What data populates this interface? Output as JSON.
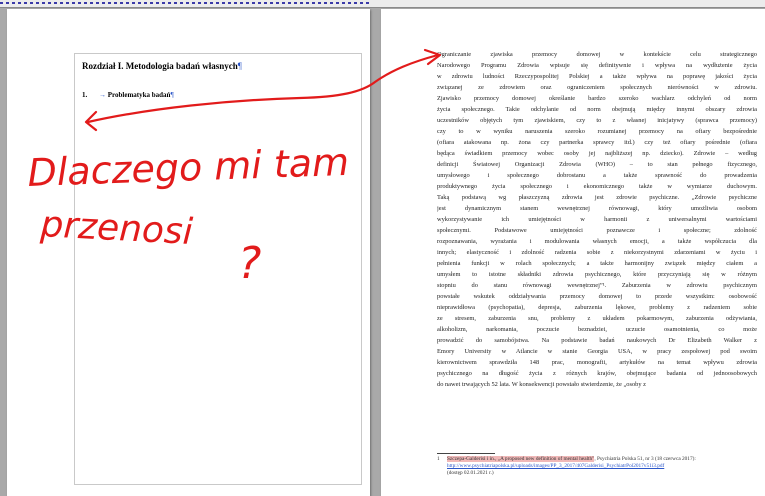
{
  "left_page": {
    "chapter_title": "Rozdział I. Metodologia badań własnych",
    "pilcrow": "¶",
    "section_number": "1.",
    "section_arrow": "→",
    "section_title": "Problematyka badań"
  },
  "right_page": {
    "body_lines": [
      "Ograniczanie zjawiska przemocy domowej w kontekście celu strategicznego",
      "Narodowego Programu Zdrowia wpisuje się definitywnie i wpływa na wydłużenie życia",
      "w zdrowiu ludności Rzeczypospolitej Polskiej a także wpływa na poprawę jakości życia",
      "związanej ze zdrowiem oraz ograniczeniem społecznych nierówności w zdrowiu.",
      "Zjawisko przemocy domowej określanie bardzo szeroko wachlarz odchyleń od norm",
      "życia społecznego. Takie odchylanie od norm obejmują między innymi obszary zdrowia",
      "uczestników objętych tym zjawiskiem, czy to z własnej inicjatywy (sprawca przemocy)",
      "czy to w wyniku naruszenia szeroko rozumianej przemocy na ofiary bezpośrednie",
      "(ofiara atakowana np. żona czy partnerka sprawcy itd.) czy też ofiary pośrednie (ofiara",
      "będąca świadkiem przemocy wobec osoby jej najbliższej np. dziecko). Zdrowie – według",
      "definicji Światowej Organizacji Zdrowia (WHO) – to stan pełnego fizycznego,",
      "umysłowego i społecznego dobrostanu a także sprawność do prowadzenia",
      "produktywnego życia społecznego i ekonomicznego także w wymiarze duchowym.",
      "Taką podstawą wg płaszczyzną zdrowia jest zdrowie psychiczne. „Zdrowie psychiczne",
      "jest dynamicznym stanem wewnętrznej równowagi, który umożliwia osobom",
      "wykorzystywanie ich umiejętności w harmonii z uniwersalnymi wartościami",
      "społecznymi. Podstawowe umiejętności poznawcze i społeczne; zdolność",
      "rozpoznawania, wyrażania i modulowania własnych emocji, a także współczucia dla",
      "innych; elastyczność i zdolność radzenia sobie z niekorzystnymi zdarzeniami w życiu i",
      "pełnienia funkcji w rolach społecznych; a także harmonijny związek między ciałem a",
      "umysłem to istotne składniki zdrowia psychicznego, które przyczyniają się w różnym",
      "stopniu do stanu równowagi wewnętrznej”¹. Zaburzenia w zdrowiu psychicznym",
      "powstałe wskutek oddziaływania przemocy domowej to przede wszystkim: osobowość",
      "nieprawidłowa (psychopatia), depresja, zaburzenia lękowe, problemy z radzeniem sobie",
      "ze stresem, zaburzenia snu, problemy z układem pokarmowym, zaburzenia odżywiania,",
      "alkoholizm, narkomania, poczucie beznadziei, uczucie osamotnienia, co może",
      "prowadzić do samobójstwa. Na podstawie badań naukowych Dr Elizabeth Walker z",
      "Emory University w Atlancie w stanie Georgia USA, w pracy zespołowej pod swoim",
      "kierownictwem sprawdziła 148 prac, monografii, artykułów na temat wpływu zdrowia",
      "psychicznego na długość życia z różnych krajów, obejmujące badania od jednoosobowych",
      "do nawet trwających 52 lata. W konsekwencji powstało stwierdzenie, że „osoby z"
    ],
    "footnote_number": "1",
    "footnote_highlight": "Szczepa-Galderisi i in., „A proposed new definition of mental health\"",
    "footnote_tail": ", Psychiatria Polska 51, nr 3 (18 czerwca 2017):",
    "footnote_link": "http://www.psychiatriapolska.pl/uploads/images/PP_3_2017/407Galderisi_PsychiatrPol2017v51i3.pdf",
    "footnote_accessed": "(dostęp 02.01.2021 r.)"
  },
  "annotation": {
    "line1": "Dlaczego mi tam",
    "line2": "przenosi",
    "question_mark": "?",
    "color": "#e21b1b"
  }
}
